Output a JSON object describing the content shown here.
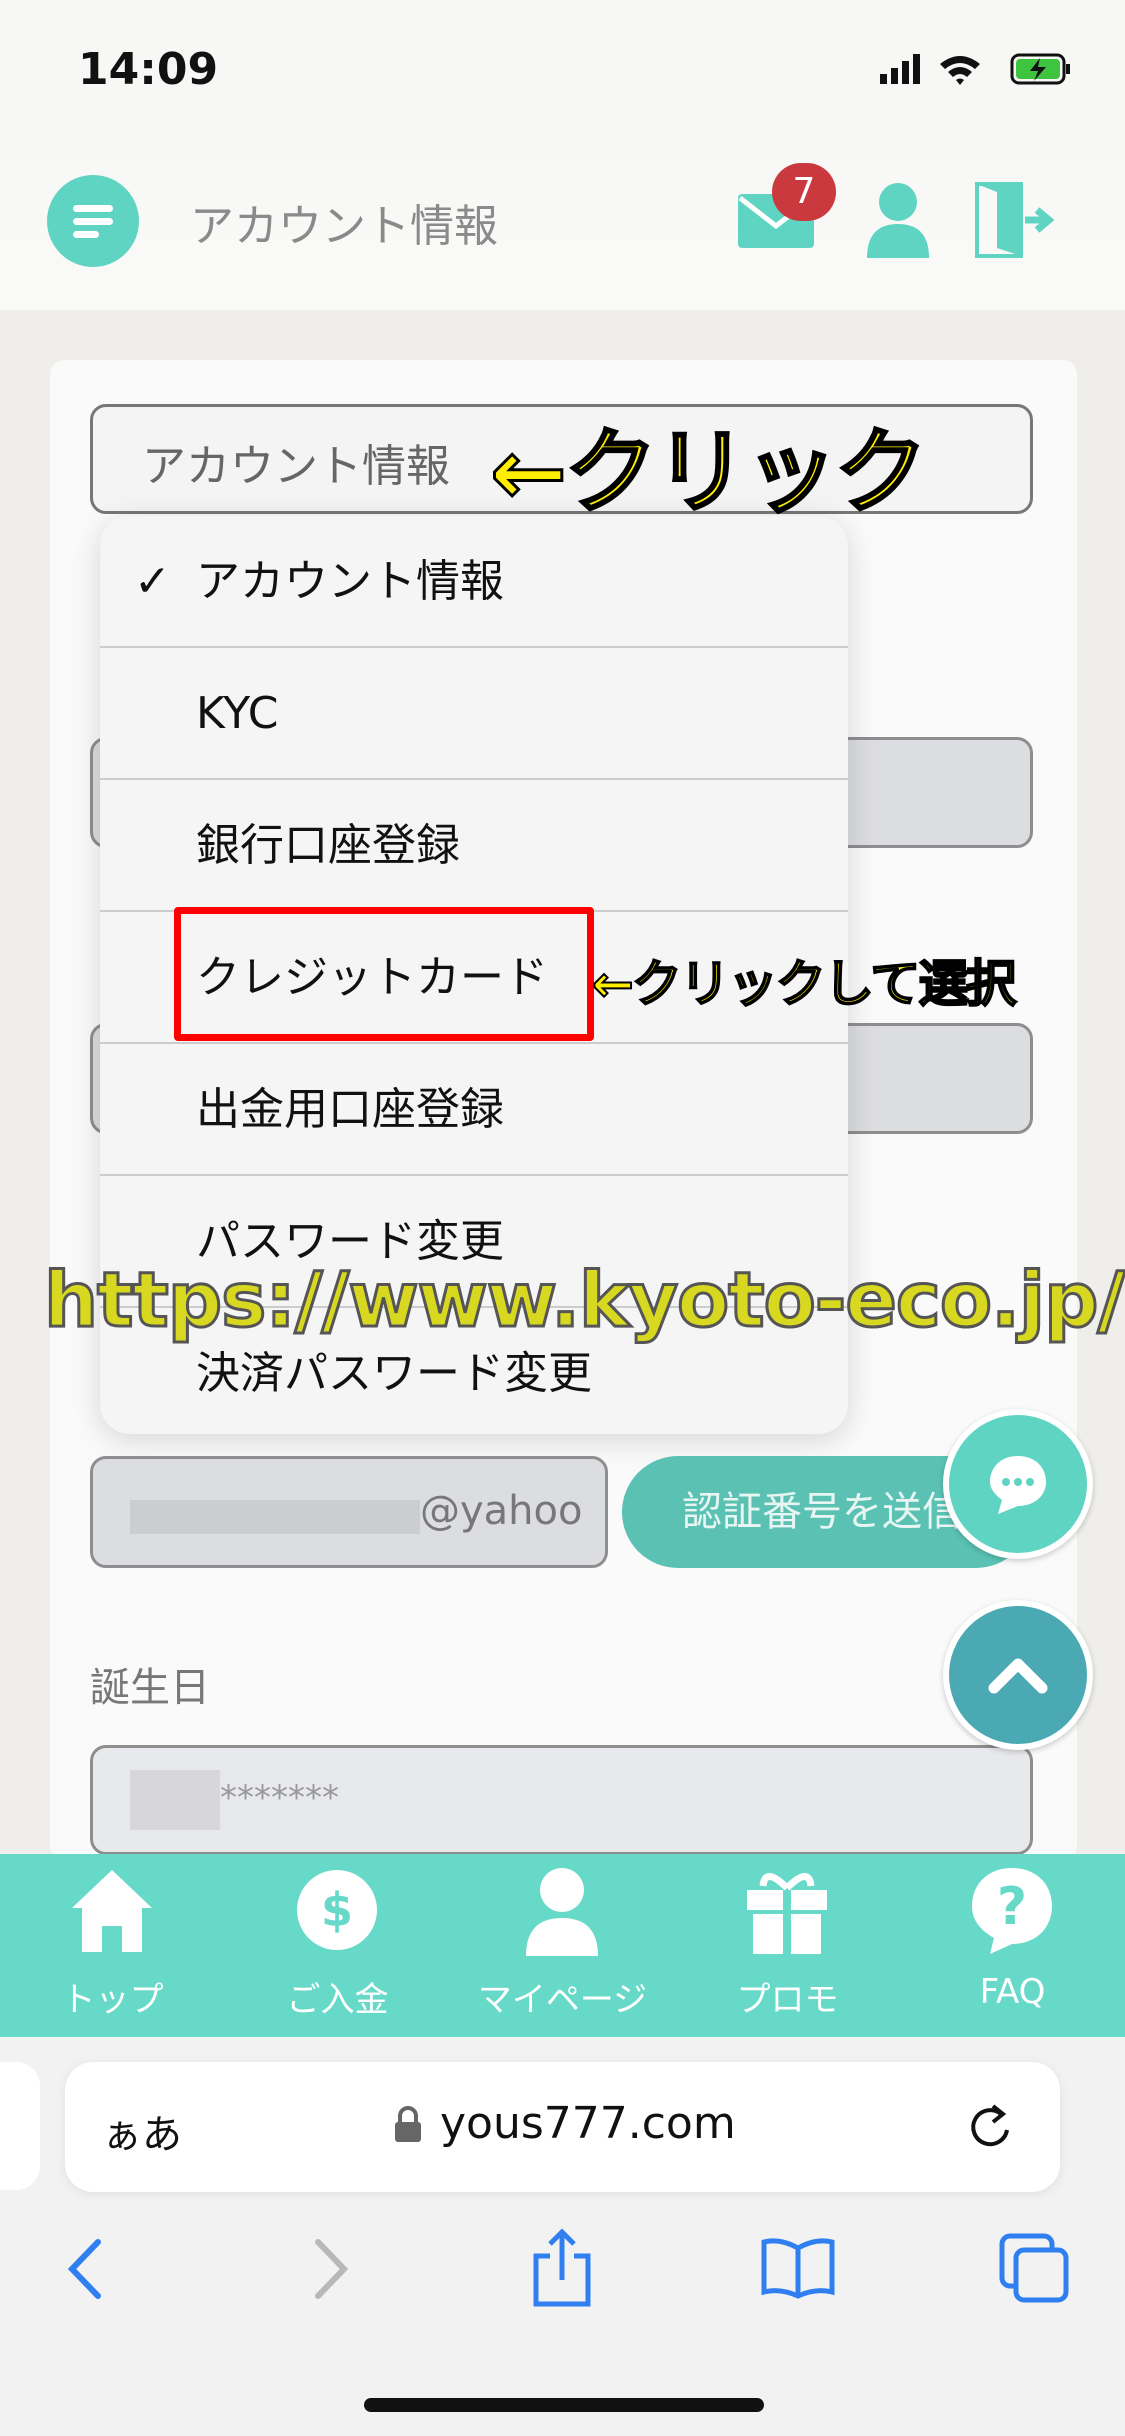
{
  "status_bar": {
    "time": "14:09"
  },
  "header": {
    "title": "アカウント情報",
    "mail_badge": "7"
  },
  "form": {
    "select_value": "アカウント情報",
    "email_value": "@yahoo",
    "send_code_button": "認証番号を送信",
    "birthday_label": "誕生日",
    "birthday_value": "*******"
  },
  "dropdown": {
    "items": [
      {
        "label": "アカウント情報",
        "selected": true
      },
      {
        "label": "KYC"
      },
      {
        "label": "銀行口座登録"
      },
      {
        "label": "クレジットカード"
      },
      {
        "label": "出金用口座登録"
      },
      {
        "label": "パスワード変更"
      },
      {
        "label": "決済パスワード変更"
      }
    ]
  },
  "annotations": {
    "click": "←クリック",
    "click_select": "←クリックして選択",
    "watermark": "https://www.kyoto-eco.jp/"
  },
  "bottom_nav": [
    {
      "label": "トップ",
      "icon": "home-icon"
    },
    {
      "label": "ご入金",
      "icon": "dollar-icon"
    },
    {
      "label": "マイページ",
      "icon": "user-icon"
    },
    {
      "label": "プロモ",
      "icon": "gift-icon"
    },
    {
      "label": "FAQ",
      "icon": "question-icon"
    }
  ],
  "browser": {
    "aa": "ぁあ",
    "url": "yous777.com"
  },
  "colors": {
    "accent": "#5fd4c2",
    "nav": "#66d9c8",
    "badge": "#c9393e",
    "annotation": "#ffee00",
    "highlight": "#ff0000"
  }
}
